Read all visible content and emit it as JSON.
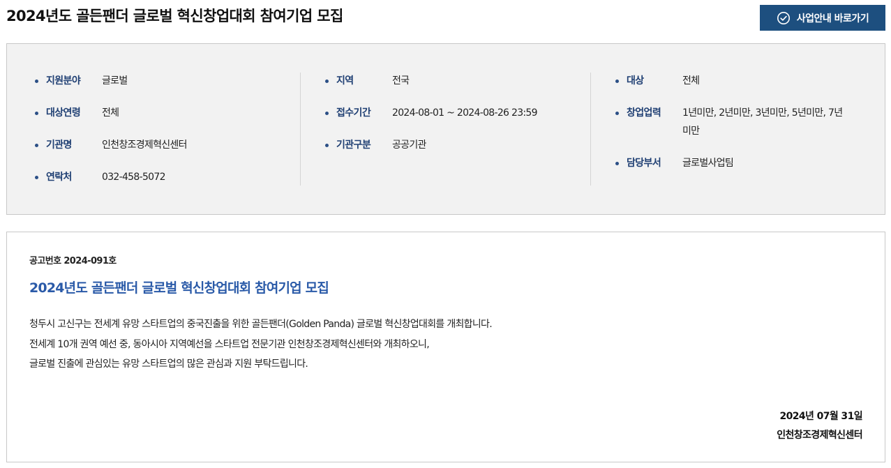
{
  "header": {
    "title": "2024년도 골든팬더 글로벌 혁신창업대회 참여기업 모집",
    "cta_label": "사업안내 바로가기"
  },
  "info": {
    "col1": [
      {
        "label": "지원분야",
        "value": "글로벌"
      },
      {
        "label": "대상연령",
        "value": "전체"
      },
      {
        "label": "기관명",
        "value": "인천창조경제혁신센터"
      },
      {
        "label": "연락처",
        "value": "032-458-5072"
      }
    ],
    "col2": [
      {
        "label": "지역",
        "value": "전국"
      },
      {
        "label": "접수기간",
        "value": "2024-08-01 ~ 2024-08-26 23:59"
      },
      {
        "label": "기관구분",
        "value": "공공기관"
      }
    ],
    "col3": [
      {
        "label": "대상",
        "value": "전체"
      },
      {
        "label": "창업업력",
        "value": "1년미만, 2년미만, 3년미만, 5년미만, 7년미만"
      },
      {
        "label": "담당부서",
        "value": "글로벌사업팀"
      }
    ]
  },
  "notice": {
    "number": "공고번호 2024-091호",
    "title": "2024년도 골든팬더 글로벌 혁신창업대회 참여기업 모집",
    "body": [
      "청두시 고신구는 전세계 유망 스타트업의 중국진출을 위한 골든팬더(Golden Panda) 글로벌 혁신창업대회를 개최합니다.",
      "전세계 10개 권역 예선 중, 동아시아 지역예선을 스타트업 전문기관 인천창조경제혁신센터와 개최하오니,",
      "글로벌 진출에 관심있는 유망 스타트업의 많은 관심과 지원 부탁드립니다."
    ],
    "date": "2024년 07월 31일",
    "issuer": "인천창조경제혁신센터"
  },
  "colors": {
    "cta_bg": "#1d4f7f",
    "label": "#1f3f73",
    "notice_title": "#2a5aa8",
    "info_bg": "#f2f2f2"
  },
  "icons": {
    "cta": "check-circle-icon"
  }
}
